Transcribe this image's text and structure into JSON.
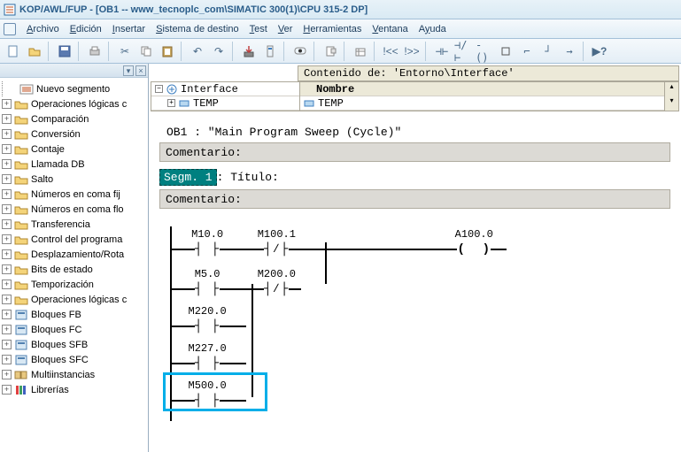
{
  "title": "KOP/AWL/FUP  - [OB1 -- www_tecnoplc_com\\SIMATIC 300(1)\\CPU 315-2 DP]",
  "menu": {
    "items": [
      "Archivo",
      "Edición",
      "Insertar",
      "Sistema de destino",
      "Test",
      "Ver",
      "Herramientas",
      "Ventana",
      "Ayuda"
    ]
  },
  "tree": {
    "items": [
      {
        "icon": "seg",
        "label": "Nuevo segmento"
      },
      {
        "icon": "fld",
        "label": "Operaciones lógicas c"
      },
      {
        "icon": "fld",
        "label": "Comparación"
      },
      {
        "icon": "fld",
        "label": "Conversión"
      },
      {
        "icon": "fld",
        "label": "Contaje"
      },
      {
        "icon": "fld",
        "label": "Llamada DB"
      },
      {
        "icon": "fld",
        "label": "Salto"
      },
      {
        "icon": "fld",
        "label": "Números en coma fij"
      },
      {
        "icon": "fld",
        "label": "Números en coma flo"
      },
      {
        "icon": "fld",
        "label": "Transferencia"
      },
      {
        "icon": "fld",
        "label": "Control del programa"
      },
      {
        "icon": "fld",
        "label": "Desplazamiento/Rota"
      },
      {
        "icon": "fld",
        "label": "Bits de estado"
      },
      {
        "icon": "fld",
        "label": "Temporización"
      },
      {
        "icon": "fld",
        "label": "Operaciones lógicas c"
      },
      {
        "icon": "blk",
        "label": "Bloques FB"
      },
      {
        "icon": "blk",
        "label": "Bloques FC"
      },
      {
        "icon": "blk",
        "label": "Bloques SFB"
      },
      {
        "icon": "blk",
        "label": "Bloques SFC"
      },
      {
        "icon": "mul",
        "label": "Multiinstancias"
      },
      {
        "icon": "lib",
        "label": "Librerías"
      }
    ]
  },
  "path_label": "Contenido de: 'Entorno\\Interface'",
  "iface": {
    "left_root": "Interface",
    "left_child": "TEMP",
    "right_header": "Nombre",
    "right_row": "TEMP"
  },
  "ob": {
    "line": "OB1 :   \"Main Program Sweep (Cycle)\"",
    "coment_label": "Comentario:",
    "seg_label": "Segm. 1",
    "titulo": ": Título:"
  },
  "ladder": {
    "contacts": {
      "r1c1": "M10.0",
      "r1c2": "M100.1",
      "r1out": "A100.0",
      "r2c1": "M5.0",
      "r2c2": "M200.0",
      "r3c1": "M220.0",
      "r4c1": "M227.0",
      "r5c1": "M500.0"
    }
  }
}
